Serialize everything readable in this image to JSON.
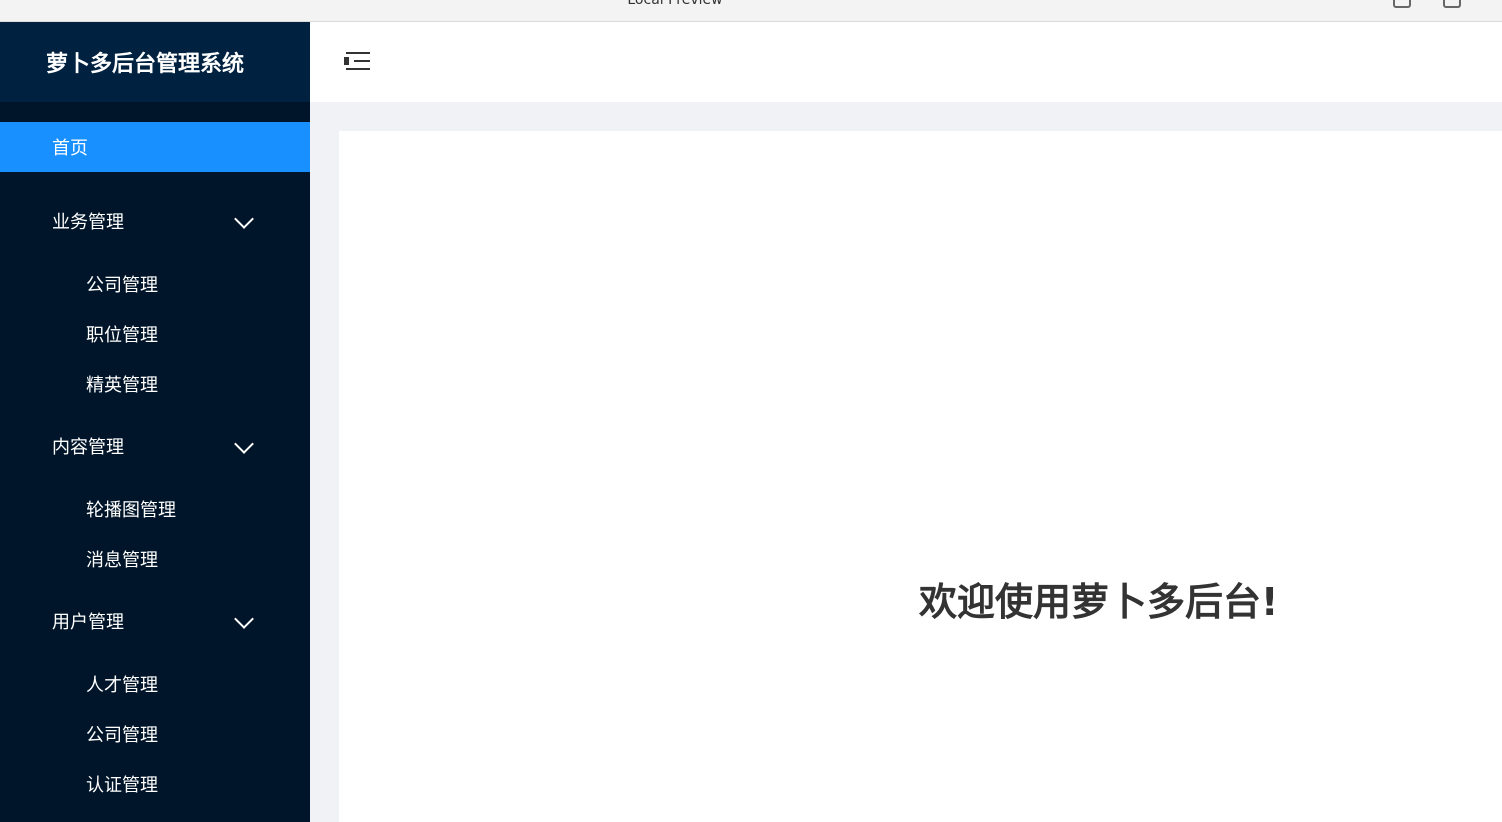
{
  "window": {
    "title": "Local Preview"
  },
  "sidebar": {
    "logo_text": "萝卜多后台管理系统",
    "home": "首页",
    "groups": [
      {
        "title": "业务管理",
        "items": [
          "公司管理",
          "职位管理",
          "精英管理"
        ]
      },
      {
        "title": "内容管理",
        "items": [
          "轮播图管理",
          "消息管理"
        ]
      },
      {
        "title": "用户管理",
        "items": [
          "人才管理",
          "公司管理",
          "认证管理"
        ]
      }
    ]
  },
  "main": {
    "welcome_text": "欢迎使用萝卜多后台!"
  },
  "colors": {
    "sidebar_bg": "#001529",
    "logo_bg": "#002140",
    "active_item": "#1890ff",
    "page_bg": "#f0f2f5"
  }
}
